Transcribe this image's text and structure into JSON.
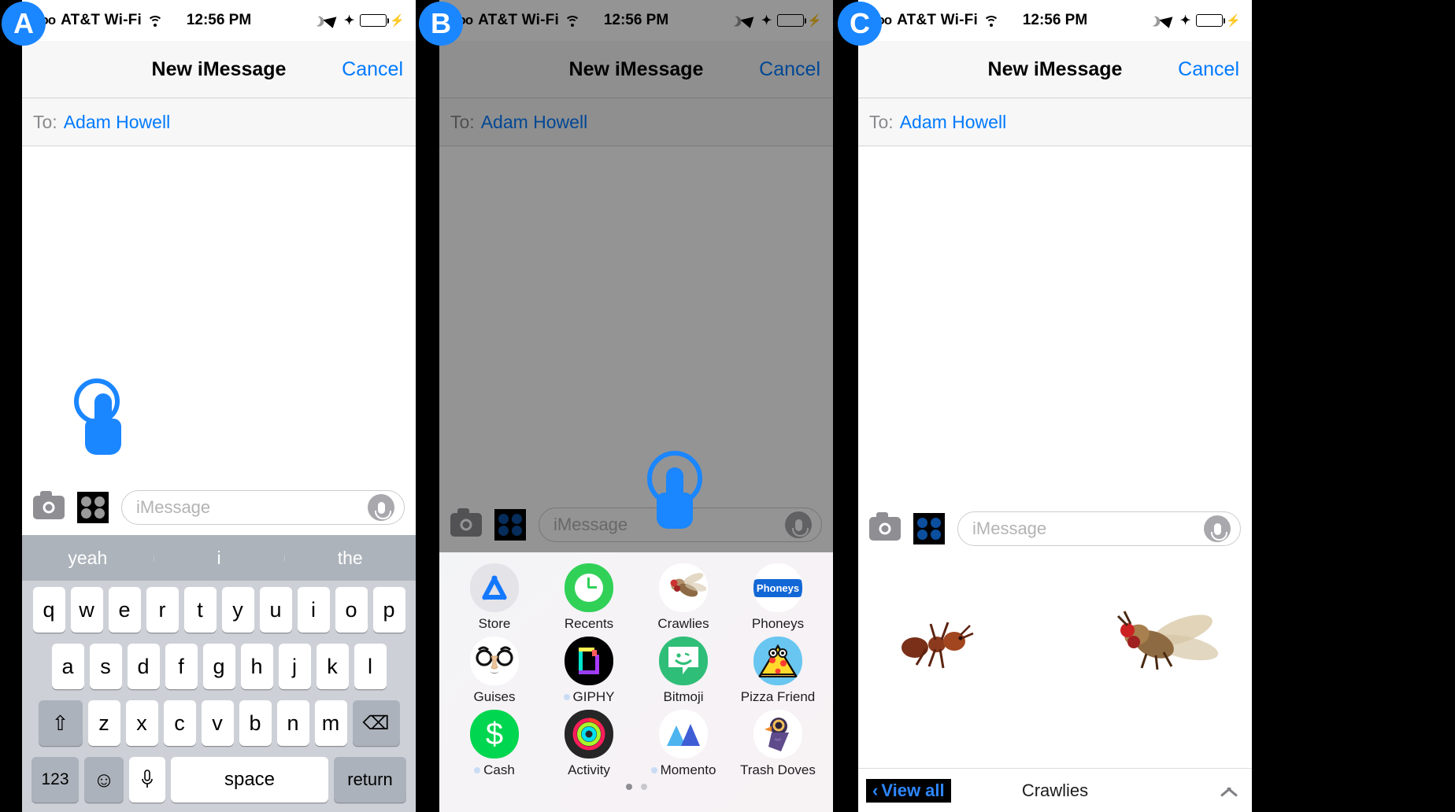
{
  "badges": {
    "a": "A",
    "b": "B",
    "c": "C"
  },
  "status_bar": {
    "carrier": "AT&T Wi-Fi",
    "signal_dots": "ooo",
    "time": "12:56 PM",
    "icons": [
      "moon-icon",
      "location-arrow-icon",
      "bluetooth-icon",
      "battery-icon",
      "charging-bolt-icon"
    ]
  },
  "nav": {
    "title": "New iMessage",
    "cancel_label": "Cancel"
  },
  "recipient": {
    "to_label": "To:",
    "name": "Adam Howell"
  },
  "input_bar": {
    "camera_icon": "camera-icon",
    "apps_icon": "app-drawer-icon",
    "placeholder": "iMessage",
    "mic_icon": "microphone-icon"
  },
  "predictive": [
    "yeah",
    "i",
    "the"
  ],
  "keyboard": {
    "row1": [
      "q",
      "w",
      "e",
      "r",
      "t",
      "y",
      "u",
      "i",
      "o",
      "p"
    ],
    "row2": [
      "a",
      "s",
      "d",
      "f",
      "g",
      "h",
      "j",
      "k",
      "l"
    ],
    "row3": [
      "z",
      "x",
      "c",
      "v",
      "b",
      "n",
      "m"
    ],
    "shift_label": "⇧",
    "delete_label": "⌫",
    "numbers_label": "123",
    "emoji_label": "☺",
    "mic_label": "🎤",
    "space_label": "space",
    "return_label": "return"
  },
  "app_drawer": {
    "apps": [
      {
        "label": "Store",
        "icon": "app-store-icon",
        "new_dot": false
      },
      {
        "label": "Recents",
        "icon": "recents-clock-icon",
        "new_dot": false
      },
      {
        "label": "Crawlies",
        "icon": "fly-icon",
        "new_dot": false
      },
      {
        "label": "Phoneys",
        "icon": "phoneys-icon",
        "new_dot": false
      },
      {
        "label": "Guises",
        "icon": "glasses-nose-icon",
        "new_dot": false
      },
      {
        "label": "GIPHY",
        "icon": "giphy-icon",
        "new_dot": true
      },
      {
        "label": "Bitmoji",
        "icon": "bitmoji-icon",
        "new_dot": false
      },
      {
        "label": "Pizza Friend",
        "icon": "pizza-friend-icon",
        "new_dot": false
      },
      {
        "label": "Cash",
        "icon": "cash-dollar-icon",
        "new_dot": true
      },
      {
        "label": "Activity",
        "icon": "activity-rings-icon",
        "new_dot": false
      },
      {
        "label": "Momento",
        "icon": "momento-mountain-icon",
        "new_dot": true
      },
      {
        "label": "Trash Doves",
        "icon": "trash-doves-icon",
        "new_dot": false
      }
    ],
    "phoneys_badge": "Phoneys",
    "cash_symbol": "$",
    "page_count": 2,
    "active_page": 1
  },
  "sticker_pane": {
    "view_all_label": "View all",
    "back_chevron": "‹",
    "pack_name": "Crawlies",
    "expand_icon": "chevron-up-icon",
    "stickers": [
      "ant-sticker",
      "fly-sticker"
    ]
  },
  "colors": {
    "accent_blue": "#007aff",
    "highlight_blue": "#1a86ff",
    "keyboard_bg": "#cdd1d7",
    "predictive_bg": "#adb3bb"
  }
}
